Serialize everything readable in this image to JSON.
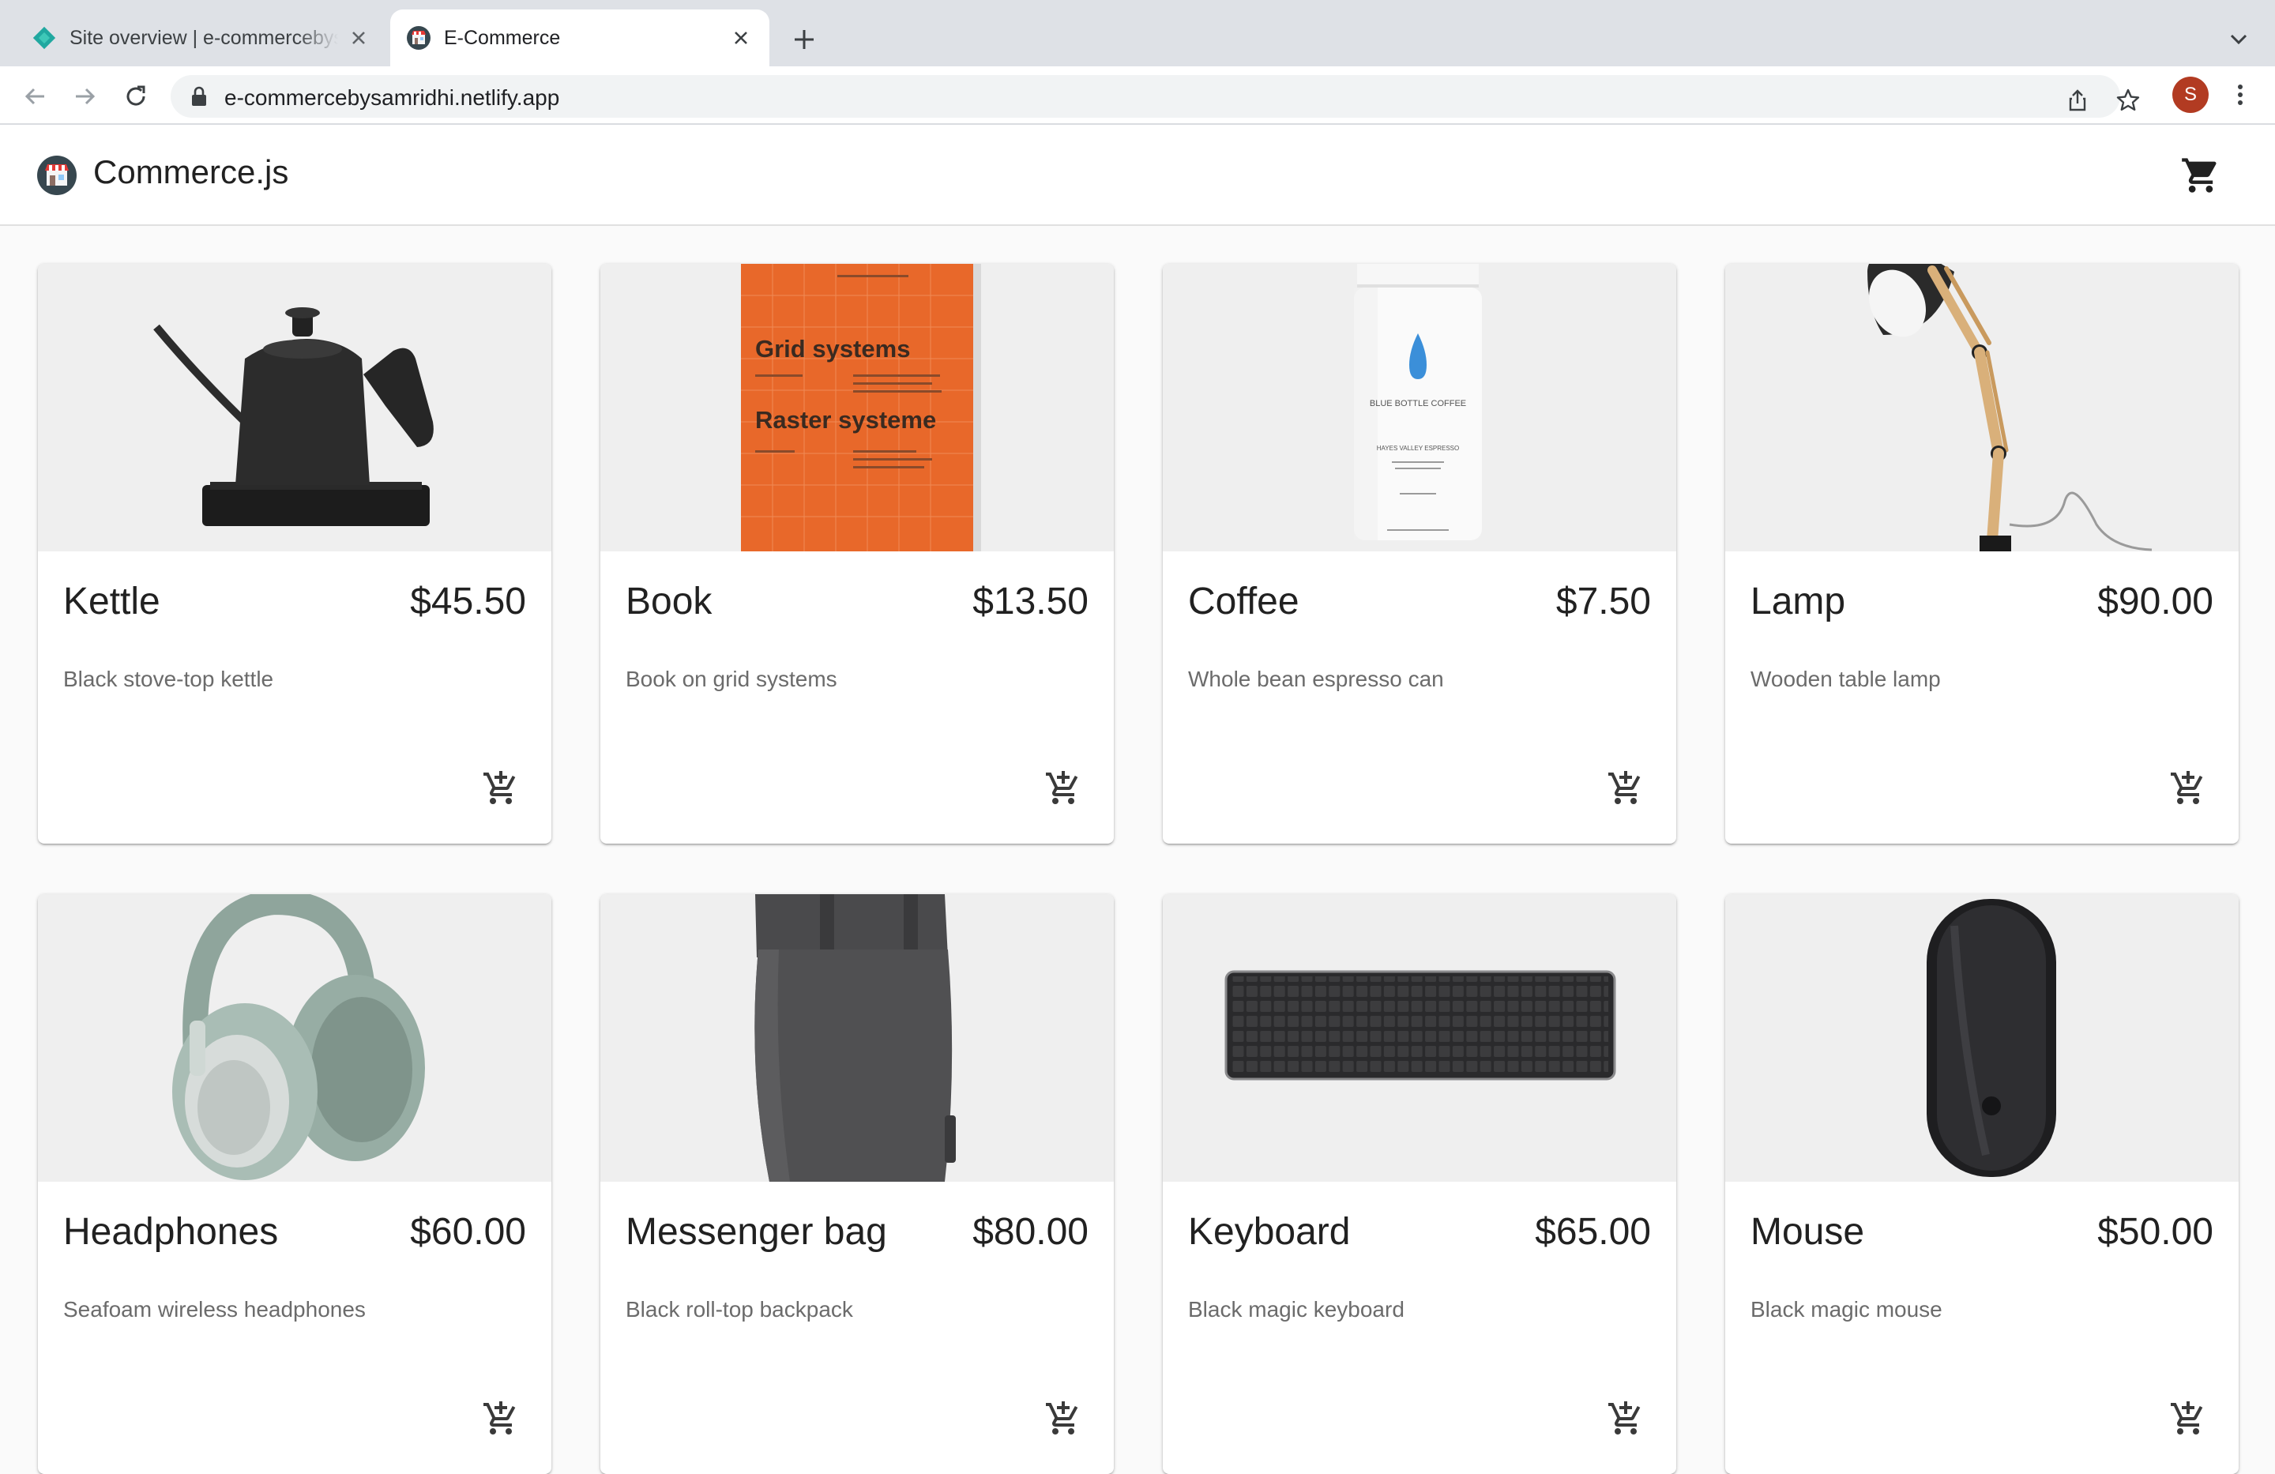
{
  "browser": {
    "tabs": [
      {
        "title": "Site overview | e-commercebysamridhi",
        "icon": "netlify-icon",
        "active": false
      },
      {
        "title": "E-Commerce",
        "icon": "store-icon",
        "active": true
      }
    ],
    "address": "e-commercebysamridhi.netlify.app",
    "profile_initial": "S",
    "profile_color": "#b23b22"
  },
  "header": {
    "brand": "Commerce.js",
    "cart_icon": "shopping-cart-icon"
  },
  "products": [
    {
      "name": "Kettle",
      "price": "$45.50",
      "description": "Black stove-top kettle",
      "image": "kettle"
    },
    {
      "name": "Book",
      "price": "$13.50",
      "description": "Book on grid systems",
      "image": "book",
      "image_text": {
        "title1": "Grid systems",
        "title2": "Raster systeme"
      }
    },
    {
      "name": "Coffee",
      "price": "$7.50",
      "description": "Whole bean espresso can",
      "image": "coffee",
      "image_text": {
        "brand": "BLUE BOTTLE COFFEE",
        "blend": "HAYES VALLEY ESPRESSO"
      }
    },
    {
      "name": "Lamp",
      "price": "$90.00",
      "description": "Wooden table lamp",
      "image": "lamp"
    },
    {
      "name": "Headphones",
      "price": "$60.00",
      "description": "Seafoam wireless headphones",
      "image": "headphones"
    },
    {
      "name": "Messenger bag",
      "price": "$80.00",
      "description": "Black roll-top backpack",
      "image": "backpack"
    },
    {
      "name": "Keyboard",
      "price": "$65.00",
      "description": "Black magic keyboard",
      "image": "keyboard"
    },
    {
      "name": "Mouse",
      "price": "$50.00",
      "description": "Black magic mouse",
      "image": "mouse"
    }
  ],
  "colors": {
    "accent": "#212121",
    "book_orange": "#e8682a",
    "coffee_blue": "#3b8fd9"
  }
}
